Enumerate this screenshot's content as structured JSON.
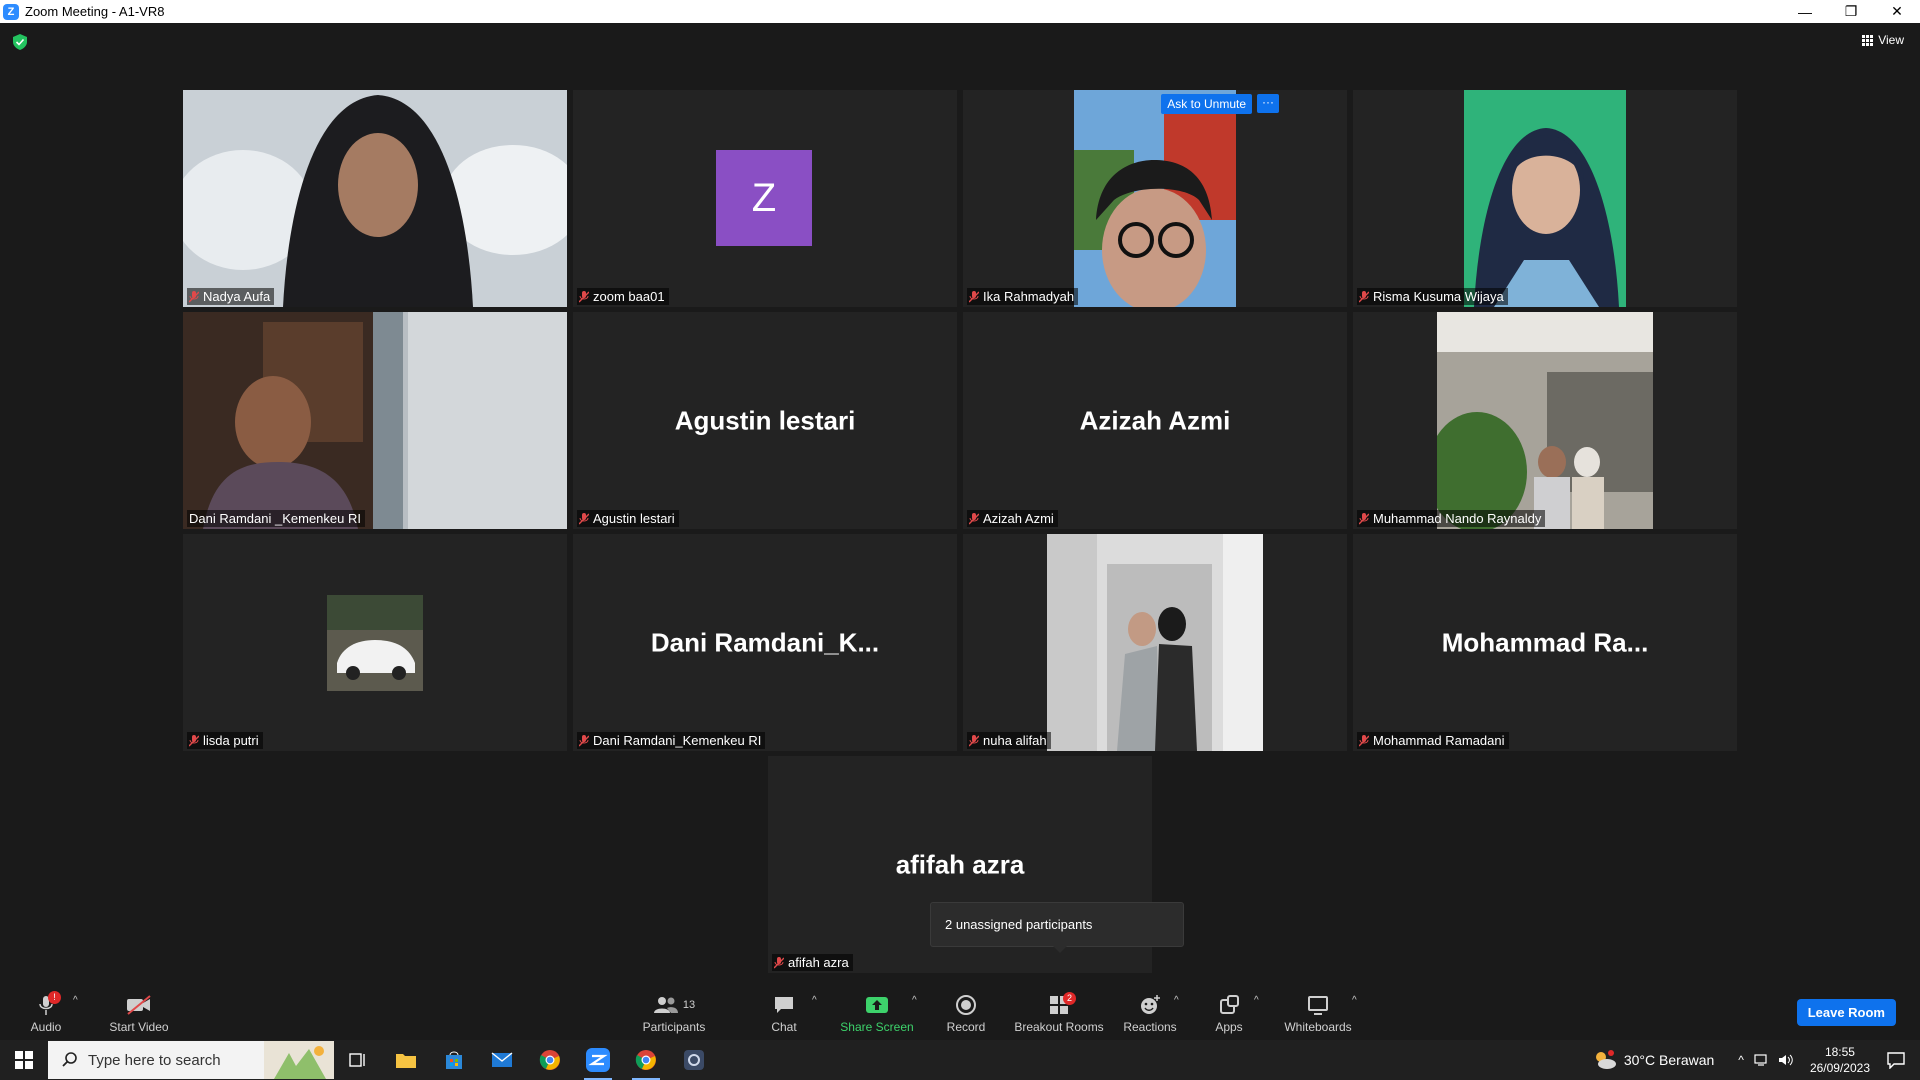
{
  "window": {
    "title": "Zoom Meeting - A1-VR8",
    "logo_letter": "Z",
    "minimize": "—",
    "restore": "❐",
    "close": "✕"
  },
  "top": {
    "view_label": "View"
  },
  "tiles": [
    {
      "name": "Nadya Aufa"
    },
    {
      "name": "zoom baa01",
      "avatar_letter": "Z"
    },
    {
      "name": "Ika Rahmadyah",
      "ask_unmute": "Ask to Unmute",
      "more": "···"
    },
    {
      "name": "Risma Kusuma Wijaya"
    },
    {
      "name": "Dani Ramdani _Kemenkeu RI"
    },
    {
      "name": "Agustin lestari",
      "big": "Agustin lestari"
    },
    {
      "name": "Azizah Azmi",
      "big": "Azizah Azmi"
    },
    {
      "name": "Muhammad Nando Raynaldy"
    },
    {
      "name": "lisda putri"
    },
    {
      "name": "Dani Ramdani_Kemenkeu RI",
      "big": "Dani  Ramdani_K..."
    },
    {
      "name": "nuha alifah"
    },
    {
      "name": "Mohammad Ramadani",
      "big": "Mohammad  Ra..."
    },
    {
      "name": "afifah azra",
      "big": "afifah azra"
    }
  ],
  "popup": {
    "text": "2 unassigned participants"
  },
  "toolbar": {
    "audio": "Audio",
    "audio_badge": "!",
    "start_video": "Start Video",
    "participants": "Participants",
    "participants_count": "13",
    "chat": "Chat",
    "share_screen": "Share Screen",
    "record": "Record",
    "breakout_rooms": "Breakout Rooms",
    "breakout_badge": "2",
    "reactions": "Reactions",
    "apps": "Apps",
    "whiteboards": "Whiteboards",
    "leave_room": "Leave Room",
    "caret": "^"
  },
  "taskbar": {
    "search_placeholder": "Type here to search",
    "weather": "30°C  Berawan",
    "time": "18:55",
    "date": "26/09/2023"
  }
}
